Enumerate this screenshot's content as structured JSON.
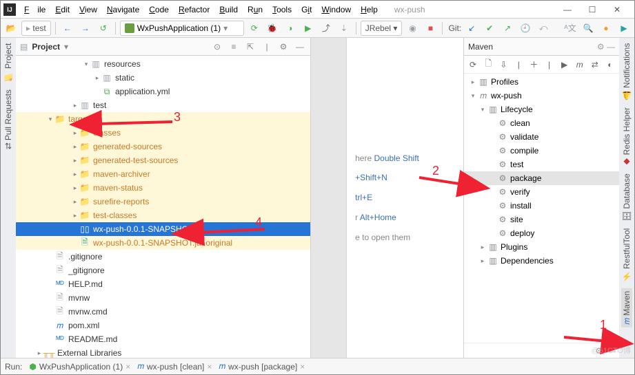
{
  "window": {
    "app_title": "wx-push"
  },
  "menu": {
    "file": "File",
    "edit": "Edit",
    "view": "View",
    "navigate": "Navigate",
    "code": "Code",
    "refactor": "Refactor",
    "build": "Build",
    "run": "Run",
    "tools": "Tools",
    "git": "Git",
    "window": "Window",
    "help": "Help"
  },
  "toolbar": {
    "nav_chip": "test",
    "run_config": "WxPushApplication (1)",
    "jrebel": "JRebel",
    "git_label": "Git:"
  },
  "project_panel": {
    "title": "Project"
  },
  "tree": {
    "resources": "resources",
    "static": "static",
    "appyml": "application.yml",
    "test": "test",
    "target": "target",
    "classes": "classes",
    "gensrc": "generated-sources",
    "gentest": "generated-test-sources",
    "mvnarc": "maven-archiver",
    "mvnstat": "maven-status",
    "surefire": "surefire-reports",
    "testcls": "test-classes",
    "jar": "wx-push-0.0.1-SNAPSHOT.jar",
    "jarorig": "wx-push-0.0.1-SNAPSHOT.jar.original",
    "gitignore1": ".gitignore",
    "gitignore2": "_gitignore",
    "help": "HELP.md",
    "mvnw": "mvnw",
    "mvnwcmd": "mvnw.cmd",
    "pom": "pom.xml",
    "readme": "README.md",
    "extlib": "External Libraries"
  },
  "hints": {
    "l1a": "here ",
    "l1b": "Double Shift",
    "l2": "+Shift+N",
    "l3": "trl+E",
    "l4a": "r ",
    "l4b": "Alt+Home",
    "l5": "e to open them"
  },
  "maven": {
    "title": "Maven",
    "profiles": "Profiles",
    "project": "wx-push",
    "lifecycle": "Lifecycle",
    "clean": "clean",
    "validate": "validate",
    "compile": "compile",
    "test": "test",
    "package": "package",
    "verify": "verify",
    "install": "install",
    "site": "site",
    "deploy": "deploy",
    "plugins": "Plugins",
    "deps": "Dependencies"
  },
  "runbar": {
    "label": "Run:",
    "tab1": "WxPushApplication (1)",
    "tab2": "wx-push [clean]",
    "tab3": "wx-push [package]"
  },
  "sidebars": {
    "project": "Project",
    "pull": "Pull Requests",
    "notifications": "Notifications",
    "redis": "Redis Helper",
    "database": "Database",
    "rest": "RestfulTool",
    "maven": "Maven"
  },
  "annotations": {
    "n1": "1",
    "n2": "2",
    "n3": "3",
    "n4": "4"
  },
  "watermark": "@51CTO博"
}
